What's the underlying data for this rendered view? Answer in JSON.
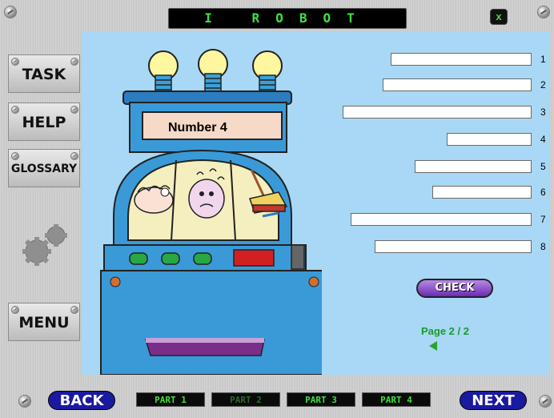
{
  "titlebar": {
    "title": "I ROBOT",
    "close_label": "x"
  },
  "sidebar": {
    "task": "TASK",
    "help": "HELP",
    "glossary": "GLOSSARY",
    "menu": "MENU"
  },
  "machine": {
    "display": "Number   4"
  },
  "answers": [
    {
      "num": "1",
      "value": ""
    },
    {
      "num": "2",
      "value": ""
    },
    {
      "num": "3",
      "value": ""
    },
    {
      "num": "4",
      "value": ""
    },
    {
      "num": "5",
      "value": ""
    },
    {
      "num": "6",
      "value": ""
    },
    {
      "num": "7",
      "value": ""
    },
    {
      "num": "8",
      "value": ""
    }
  ],
  "check_label": "CHECK",
  "page": {
    "label": "Page   2 / 2"
  },
  "nav": {
    "back": "BACK",
    "next": "NEXT",
    "parts": [
      "PART 1",
      "PART 2",
      "PART 3",
      "PART 4"
    ],
    "active_part": 2
  },
  "colors": {
    "content_bg": "#a8d8f5",
    "titlebar_text": "#3ee23e",
    "nav_blue": "#1a1aa0",
    "check_purple": "#7a3bc2"
  }
}
